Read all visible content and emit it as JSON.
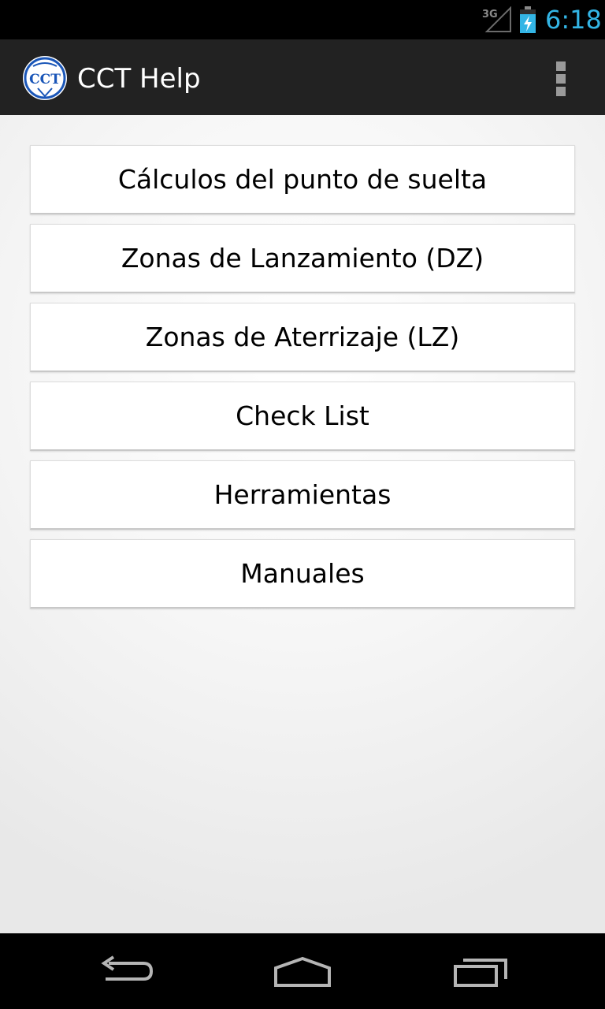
{
  "status_bar": {
    "network_type": "3G",
    "time": "6:18",
    "time_color": "#33b5e5",
    "icons": [
      "signal-icon",
      "battery-charging-icon"
    ]
  },
  "action_bar": {
    "logo_text": "CCT",
    "title": "CCT Help",
    "overflow_icon": "overflow-menu-icon"
  },
  "menu": {
    "items": [
      {
        "label": "Cálculos del punto de suelta"
      },
      {
        "label": "Zonas de Lanzamiento (DZ)"
      },
      {
        "label": "Zonas de Aterrizaje (LZ)"
      },
      {
        "label": "Check List"
      },
      {
        "label": "Herramientas"
      },
      {
        "label": "Manuales"
      }
    ]
  },
  "nav_bar": {
    "icons": [
      "back-icon",
      "home-icon",
      "recent-apps-icon"
    ]
  },
  "colors": {
    "action_bar_bg": "#222222",
    "status_bar_bg": "#000000",
    "button_bg": "#ffffff",
    "logo_blue": "#1a56b8"
  }
}
